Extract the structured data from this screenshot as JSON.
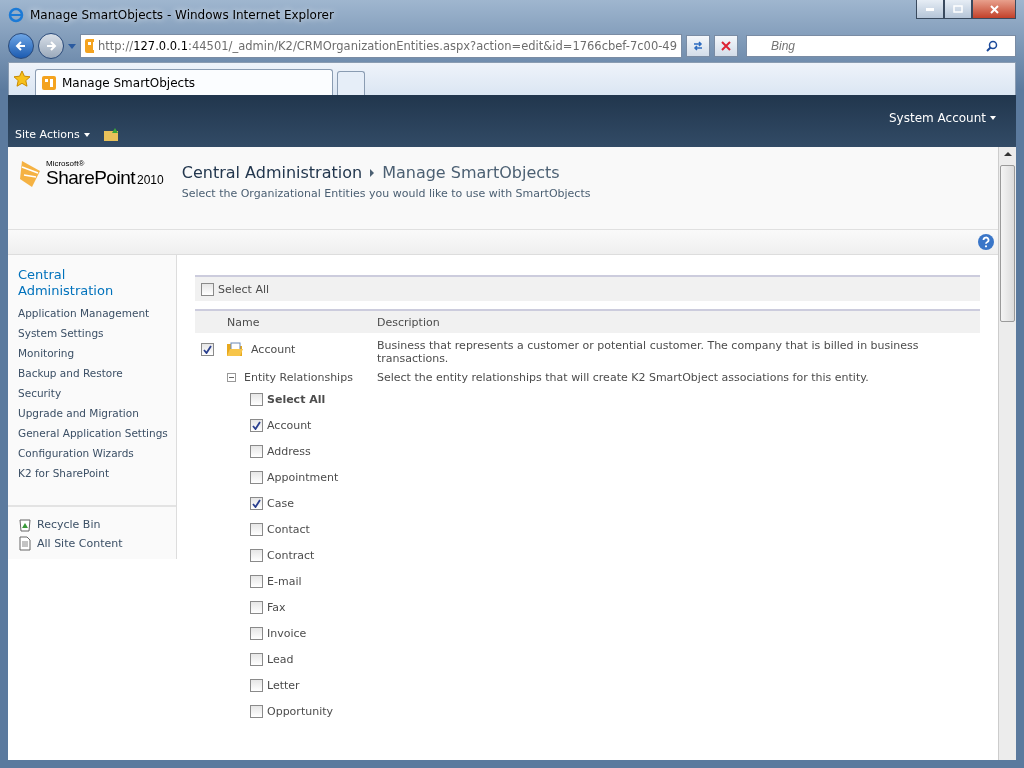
{
  "window": {
    "title": "Manage SmartObjects - Windows Internet Explorer"
  },
  "address_bar": {
    "prefix": "http://",
    "host": "127.0.0.1",
    "rest": ":44501/_admin/K2/CRMOrganizationEntities.aspx?action=edit&id=1766cbef-7c00-49"
  },
  "search": {
    "placeholder": "Bing"
  },
  "tabs": [
    {
      "label": "Manage SmartObjects",
      "selected": true
    }
  ],
  "top_bar": {
    "site_actions": "Site Actions",
    "account": "System Account"
  },
  "header": {
    "logo_small": "Microsoft®",
    "logo_main": "SharePoint",
    "logo_year": "2010",
    "breadcrumb": [
      "Central Administration",
      "Manage SmartObjects"
    ],
    "subtitle": "Select the Organizational Entities you would like to use with SmartObjects"
  },
  "sidebar": {
    "heading": "Central Administration",
    "items": [
      "Application Management",
      "System Settings",
      "Monitoring",
      "Backup and Restore",
      "Security",
      "Upgrade and Migration",
      "General Application Settings",
      "Configuration Wizards",
      "K2 for SharePoint"
    ],
    "bottom_items": [
      {
        "label": "Recycle Bin",
        "kind": "recycle"
      },
      {
        "label": "All Site Content",
        "kind": "content"
      }
    ]
  },
  "select_all": {
    "label": "Select All",
    "checked": false
  },
  "table": {
    "columns": [
      "Name",
      "Description"
    ],
    "entity": {
      "name": "Account",
      "checked": true,
      "description": "Business that represents a customer or potential customer. The company that is billed in business transactions."
    },
    "relationships": {
      "label": "Entity Relationships",
      "expanded": true,
      "description": "Select the entity relationships that will create K2 SmartObject associations for this entity.",
      "select_all": {
        "label": "Select All",
        "checked": false
      },
      "items": [
        {
          "label": "Account",
          "checked": true
        },
        {
          "label": "Address",
          "checked": false
        },
        {
          "label": "Appointment",
          "checked": false
        },
        {
          "label": "Case",
          "checked": true
        },
        {
          "label": "Contact",
          "checked": false
        },
        {
          "label": "Contract",
          "checked": false
        },
        {
          "label": "E-mail",
          "checked": false
        },
        {
          "label": "Fax",
          "checked": false
        },
        {
          "label": "Invoice",
          "checked": false
        },
        {
          "label": "Lead",
          "checked": false
        },
        {
          "label": "Letter",
          "checked": false
        },
        {
          "label": "Opportunity",
          "checked": false
        }
      ]
    }
  }
}
